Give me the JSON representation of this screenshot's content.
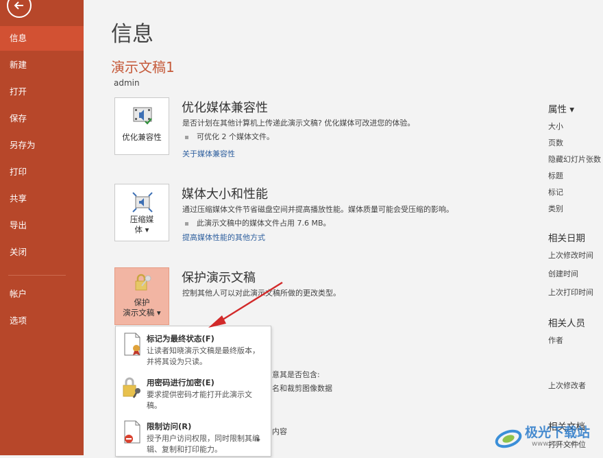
{
  "sidebar": {
    "items": [
      {
        "label": "信息"
      },
      {
        "label": "新建"
      },
      {
        "label": "打开"
      },
      {
        "label": "保存"
      },
      {
        "label": "另存为"
      },
      {
        "label": "打印"
      },
      {
        "label": "共享"
      },
      {
        "label": "导出"
      },
      {
        "label": "关闭"
      },
      {
        "label": "帐户"
      },
      {
        "label": "选项"
      }
    ]
  },
  "main": {
    "title": "信息",
    "doc_title": "演示文稿1",
    "author": "admin",
    "sections": [
      {
        "tile_label": "优化兼容性",
        "title": "优化媒体兼容性",
        "desc": "是否计划在其他计算机上传递此演示文稿? 优化媒体可改进您的体验。",
        "bullet": "可优化 2 个媒体文件。",
        "link": "关于媒体兼容性"
      },
      {
        "tile_label_1": "压缩媒",
        "tile_label_2": "体 ▾",
        "title": "媒体大小和性能",
        "desc": "通过压缩媒体文件节省磁盘空间并提高播放性能。媒体质量可能会受压缩的影响。",
        "bullet": "此演示文稿中的媒体文件占用 7.6 MB。",
        "link": "提高媒体性能的其他方式"
      },
      {
        "tile_label_1": "保护",
        "tile_label_2": "演示文稿 ▾",
        "title": "保护演示文稿",
        "desc": "控制其他人可以对此演示文稿所做的更改类型。"
      }
    ],
    "obscured": {
      "line1": "意其是否包含:",
      "line2": "名和裁剪图像数据",
      "line3": "内容"
    }
  },
  "dropdown": {
    "items": [
      {
        "title": "标记为最终状态(F)",
        "desc": "让读者知晓演示文稿是最终版本，并将其设为只读。"
      },
      {
        "title": "用密码进行加密(E)",
        "desc": "要求提供密码才能打开此演示文稿。"
      },
      {
        "title": "限制访问(R)",
        "desc": "授予用户访问权限，同时限制其编辑、复制和打印能力。",
        "arrow": "▸"
      }
    ]
  },
  "properties": {
    "header": "属性 ▾",
    "items": [
      "大小",
      "页数",
      "隐藏幻灯片张数",
      "标题",
      "标记",
      "类别"
    ],
    "dates_header": "相关日期",
    "dates": [
      "上次修改时间",
      "创建时间",
      "上次打印时间"
    ],
    "people_header": "相关人员",
    "people": [
      "作者",
      "上次修改者"
    ],
    "docs_header": "相关文档",
    "docs_item": "打开文件位"
  },
  "watermark": {
    "text": "极光下载站",
    "sub": "www.xz7.com"
  },
  "colors": {
    "sidebar": "#b7472a",
    "sidebar_active": "#d25133",
    "accent": "#c55a3a",
    "link": "#2e5f9e"
  }
}
